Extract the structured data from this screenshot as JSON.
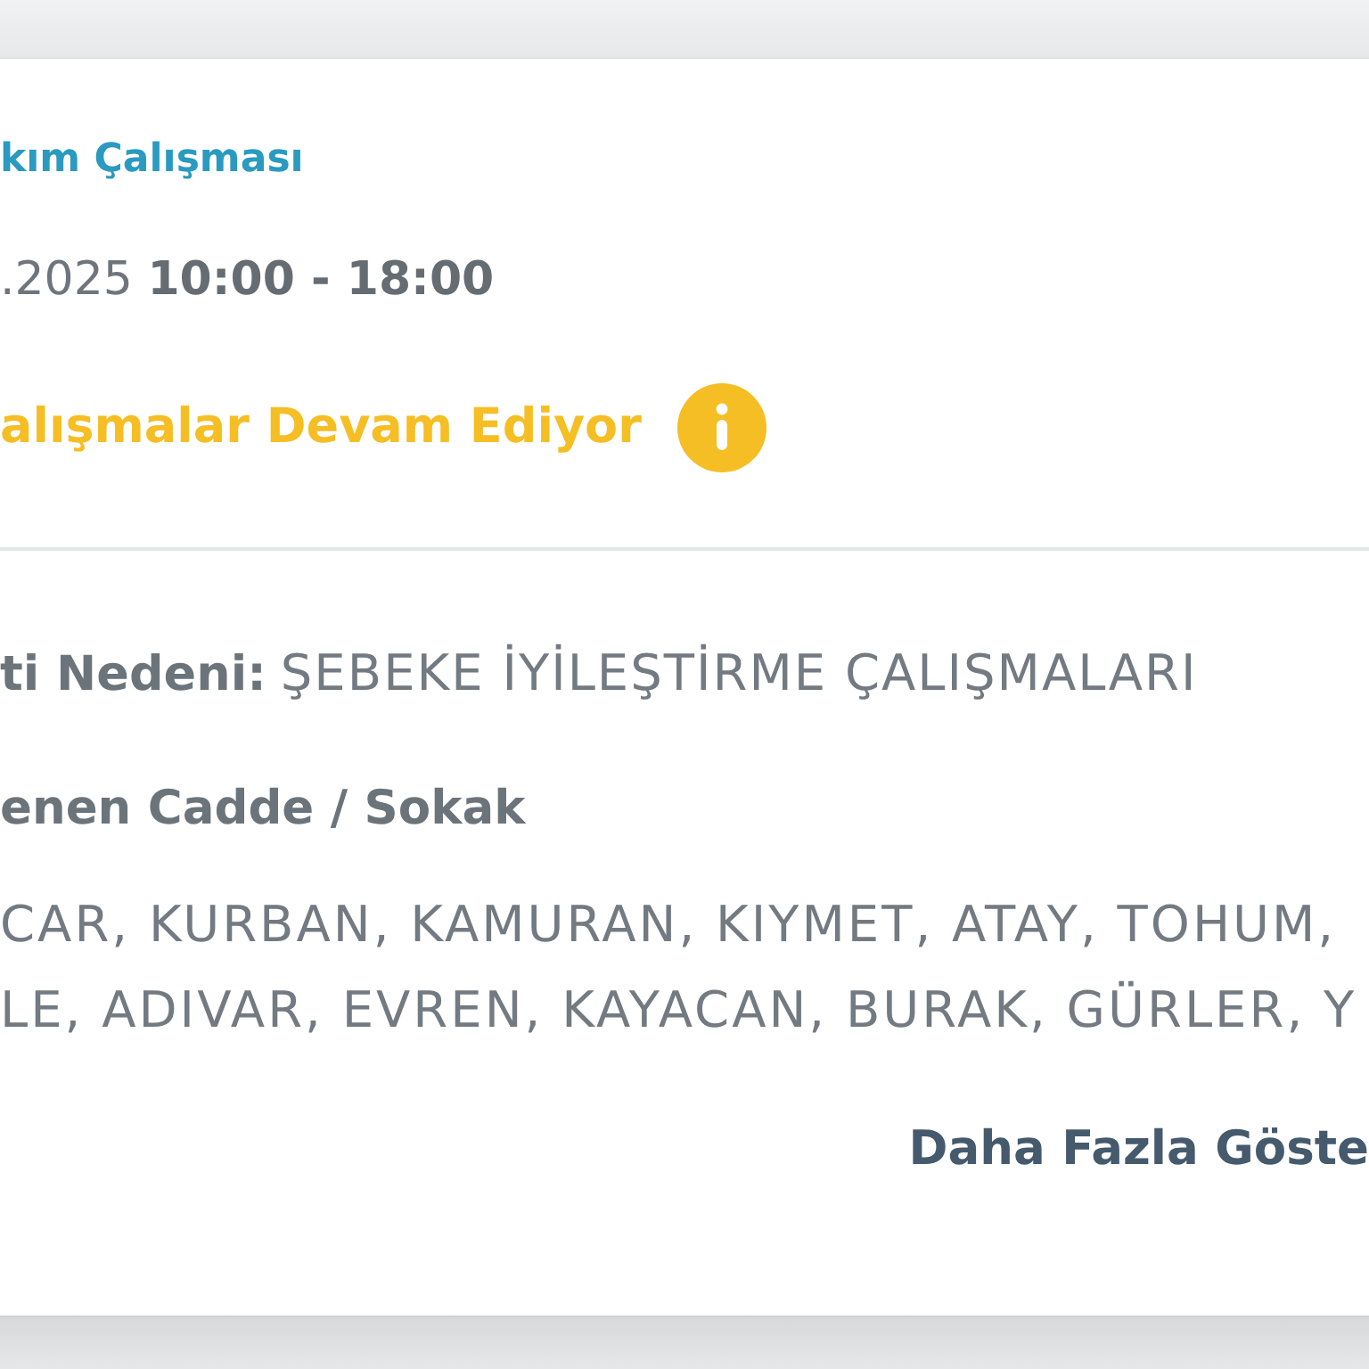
{
  "card": {
    "title": "kım Çalışması",
    "schedule": ".2025 **10:00 - 18:00**",
    "status": {
      "text": "alışmalar Devam Ediyor",
      "kind": "warning"
    },
    "reason": {
      "label": "ti Nedeni:",
      "value": "ŞEBEKE İYİLEŞTİRME ÇALIŞMALARI"
    },
    "streets": {
      "heading": "enen Cadde / Sokak",
      "lines": [
        "CAR, KURBAN, KAMURAN, KIYMET, ATAY, TOHUM,",
        "LE, ADIVAR, EVREN, KAYACAN, BURAK, GÜRLER, Y"
      ]
    },
    "more_link": "Daha Fazla Göste"
  }
}
